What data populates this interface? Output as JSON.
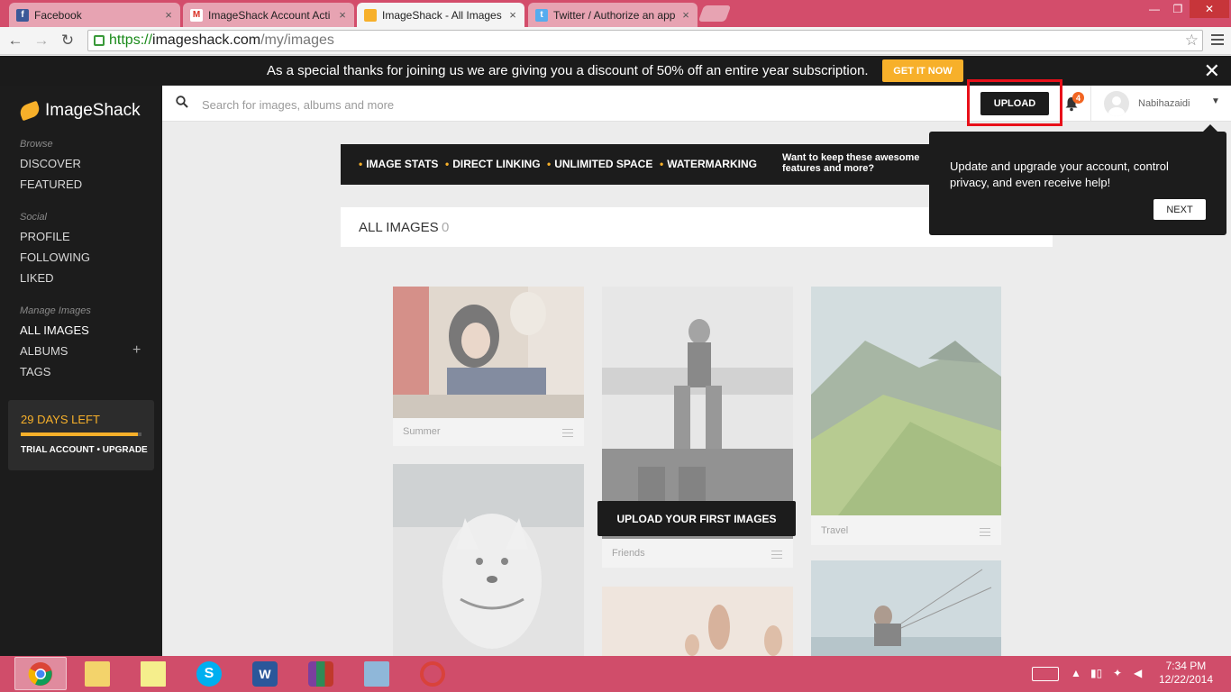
{
  "browser": {
    "tabs": [
      {
        "title": "Facebook",
        "favicon": "facebook-icon"
      },
      {
        "title": "ImageShack Account Acti",
        "favicon": "gmail-icon"
      },
      {
        "title": "ImageShack - All Images",
        "favicon": "imageshack-icon"
      },
      {
        "title": "Twitter / Authorize an app",
        "favicon": "twitter-icon"
      }
    ],
    "url_scheme": "https://",
    "url_host": "imageshack.com",
    "url_path": "/my/images"
  },
  "promo": {
    "message": "As a special thanks for joining us we are giving you a discount of 50% off an entire year subscription.",
    "cta": "GET IT NOW"
  },
  "sidebar": {
    "logo": "ImageShack",
    "browse_heading": "Browse",
    "browse": [
      "DISCOVER",
      "FEATURED"
    ],
    "social_heading": "Social",
    "social": [
      "PROFILE",
      "FOLLOWING",
      "LIKED"
    ],
    "manage_heading": "Manage Images",
    "manage": [
      "ALL IMAGES",
      "ALBUMS",
      "TAGS"
    ],
    "trial_days": "29 DAYS LEFT",
    "trial_account": "TRIAL ACCOUNT • UPGRADE",
    "trial_progress": 0.97
  },
  "header": {
    "search_placeholder": "Search for images, albums and more",
    "upload": "UPLOAD",
    "notifications": "4",
    "username": "Nabihazaidi"
  },
  "features": {
    "items": [
      "IMAGE STATS",
      "DIRECT LINKING",
      "UNLIMITED SPACE",
      "WATERMARKING"
    ],
    "question": "Want to keep these awesome features and more?"
  },
  "main": {
    "title": "ALL IMAGES",
    "count": "0",
    "cards": [
      "Summer",
      "Friends",
      "Travel"
    ],
    "upload_first": "UPLOAD YOUR FIRST IMAGES"
  },
  "tooltip": {
    "text": "Update and upgrade your account, control privacy, and even receive help!",
    "next": "NEXT"
  },
  "taskbar": {
    "time": "7:34 PM",
    "date": "12/22/2014"
  },
  "colors": {
    "accent": "#f7b02a",
    "dark": "#1c1c1c",
    "highlight": "#e8101a",
    "taskbar": "#d04d6a"
  }
}
